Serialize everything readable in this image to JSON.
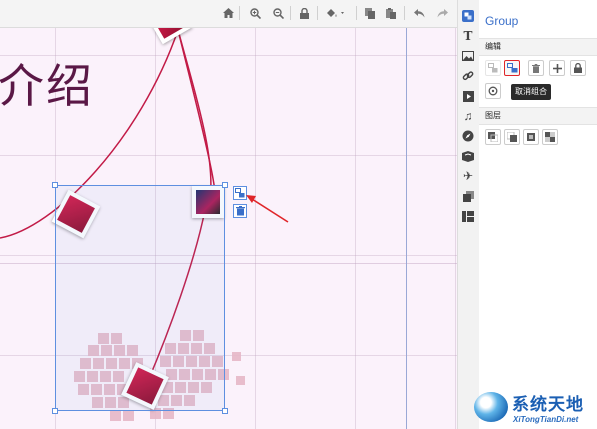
{
  "canvas": {
    "title_text": "介绍"
  },
  "toolbar": {
    "buttons": [
      "home-icon",
      "zoom-in-icon",
      "zoom-out-icon",
      "lock-icon",
      "fill-icon",
      "copy-icon",
      "paste-icon",
      "undo-icon",
      "redo-icon"
    ]
  },
  "panel": {
    "title": "Group",
    "edit_section": "编辑",
    "layer_section": "图层",
    "tooltip": "取消组合"
  },
  "watermark": {
    "cn": "系统天地",
    "en": "XiTongTianDi.net"
  },
  "colors": {
    "accent": "#3a6fc9",
    "highlight": "#e0262a",
    "curve": "#c21b47",
    "canvas_bg": "#fbf2fb"
  }
}
